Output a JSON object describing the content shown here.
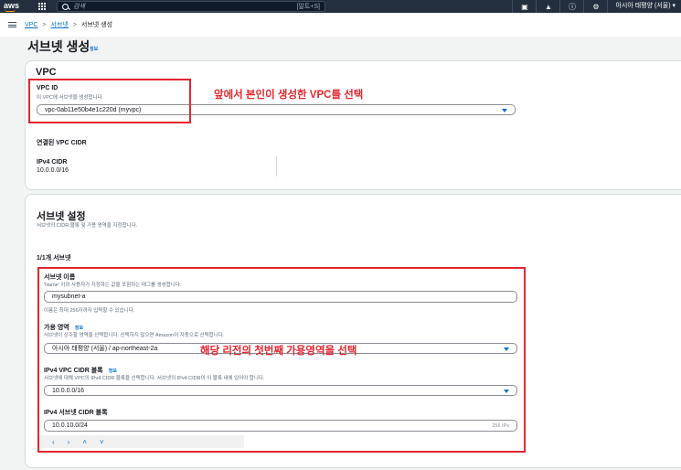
{
  "topnav": {
    "logo": "aws",
    "search_placeholder": "검색",
    "search_shortcut": "[알트+S]",
    "region": "아시아 태평양 (서울) ▾",
    "icons": [
      "terminal-icon",
      "bell-icon",
      "help-icon",
      "gear-icon"
    ]
  },
  "breadcrumb": {
    "items": [
      "VPC",
      "서브넷",
      "서브넷 생성"
    ]
  },
  "page": {
    "title": "서브넷 생성",
    "info": "정보"
  },
  "vpc_section": {
    "heading": "VPC",
    "vpc_id_label": "VPC ID",
    "vpc_id_desc": "이 VPC에 서브넷을 생성합니다.",
    "vpc_id_value": "vpc-0ab11e50b4e1c220d (myvpc)",
    "associated_cidr_heading": "연결된 VPC CIDR",
    "ipv4_cidr_label": "IPv4 CIDR",
    "ipv4_cidr_value": "10.0.0.0/16"
  },
  "subnet_section": {
    "heading": "서브넷 설정",
    "desc": "서브넷의 CIDR 블록 및 가용 영역을 지정합니다.",
    "count": "1/1개 서브넷",
    "name_label": "서브넷 이름",
    "name_desc": "'Name' 키와 사용자가 지정하는 값을 포함하는 태그를 생성합니다.",
    "name_value": "mysubnet-a",
    "name_hint": "이름은 최대 256자까지 입력할 수 있습니다.",
    "az_label": "가용 영역",
    "az_info": "정보",
    "az_desc": "서브넷이 상주할 영역을 선택합니다. 선택하지 않으면 Amazon이 자동으로 선택합니다.",
    "az_value": "아시아 태평양 (서울) / ap-northeast-2a",
    "vpc_cidr_label": "IPv4 VPC CIDR 블록",
    "vpc_cidr_info": "정보",
    "vpc_cidr_desc": "서브넷에 대해 VPC의 IPv4 CIDR 블록을 선택합니다. 서브넷의 IPv4 CIDR이 이 블록 내에 있어야 합니다.",
    "vpc_cidr_value": "10.0.0.0/16",
    "subnet_cidr_label": "IPv4 서브넷 CIDR 블록",
    "subnet_cidr_value": "10.0.10.0/24",
    "subnet_cidr_ips": "256 IPs",
    "stepper": [
      "‹",
      "›",
      "˄",
      "˅"
    ]
  },
  "annotations": {
    "vpc_note": "앞에서 본인이 생성한 VPC를 선택",
    "az_note": "해당 리전의 첫번째 가용영역을 선택"
  },
  "colors": {
    "nav_bg": "#232f3e",
    "link": "#0972d3",
    "annotation_red": "#e3262f"
  }
}
